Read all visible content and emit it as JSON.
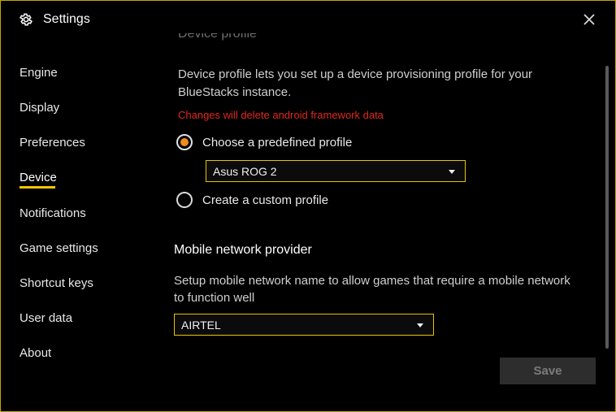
{
  "window": {
    "title": "Settings",
    "accent_color": "#f2c500",
    "border_color": "#c9a500"
  },
  "sidebar": {
    "active": "Device",
    "items": [
      {
        "label": "Engine"
      },
      {
        "label": "Display"
      },
      {
        "label": "Preferences"
      },
      {
        "label": "Device"
      },
      {
        "label": "Notifications"
      },
      {
        "label": "Game settings"
      },
      {
        "label": "Shortcut keys"
      },
      {
        "label": "User data"
      },
      {
        "label": "About"
      }
    ]
  },
  "device_profile": {
    "heading": "Device profile",
    "description": "Device profile lets you set up a device provisioning profile for your BlueStacks instance.",
    "warning": "Changes will delete android framework data",
    "warning_color": "#e1261c",
    "option_predefined": "Choose a predefined profile",
    "option_custom": "Create a custom profile",
    "selected_option": "predefined",
    "profile_value": "Asus ROG 2"
  },
  "network": {
    "heading": "Mobile network provider",
    "description": "Setup mobile network name to allow games that require a mobile network to function well",
    "provider_value": "AIRTEL"
  },
  "footer": {
    "save_label": "Save"
  }
}
